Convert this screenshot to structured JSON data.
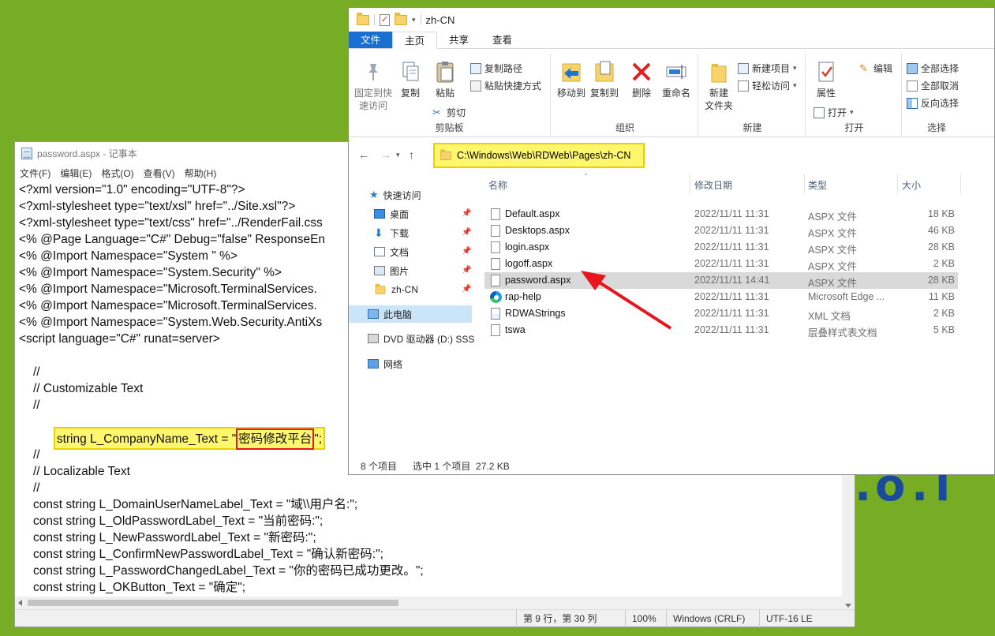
{
  "notepad": {
    "title": "password.aspx - 记事本",
    "menu": [
      "文件(F)",
      "编辑(E)",
      "格式(O)",
      "查看(V)",
      "帮助(H)"
    ],
    "lines": [
      "<?xml version=\"1.0\" encoding=\"UTF-8\"?>",
      "<?xml-stylesheet type=\"text/xsl\" href=\"../Site.xsl\"?>",
      "<?xml-stylesheet type=\"text/css\" href=\"../RenderFail.css",
      "<% @Page Language=\"C#\" Debug=\"false\" ResponseEn",
      "<% @Import Namespace=\"System \" %>",
      "<% @Import Namespace=\"System.Security\" %>",
      "<% @Import Namespace=\"Microsoft.TerminalServices.",
      "<% @Import Namespace=\"Microsoft.TerminalServices.",
      "<% @Import Namespace=\"System.Web.Security.AntiXs",
      "<script language=\"C#\" runat=server>"
    ],
    "block1": [
      "//",
      "// Customizable Text",
      "//"
    ],
    "highlight_prefix": "string L_CompanyName_Text = \"",
    "highlight_value": "密码修改平台",
    "highlight_suffix": "\";",
    "block2": [
      "//",
      "// Localizable Text",
      "//",
      "const string L_DomainUserNameLabel_Text = \"域\\\\用户名:\";",
      "const string L_OldPasswordLabel_Text = \"当前密码:\";",
      "const string L_NewPasswordLabel_Text = \"新密码:\";",
      "const string L_ConfirmNewPasswordLabel_Text = \"确认新密码:\";",
      "const string L_PasswordChangedLabel_Text = \"你的密码已成功更改。\";",
      "const string L_OKButton_Text = \"确定\";"
    ],
    "status": {
      "position": "第 9 行，第 30 列",
      "zoom": "100%",
      "line_ending": "Windows (CRLF)",
      "encoding": "UTF-16 LE"
    }
  },
  "explorer": {
    "title": "zh-CN",
    "tabs": [
      "文件",
      "主页",
      "共享",
      "查看"
    ],
    "ribbon": {
      "pin": "固定到快\n速访问",
      "copy": "复制",
      "paste": "粘贴",
      "copy_path": "复制路径",
      "paste_shortcut": "粘贴快捷方式",
      "cut": "剪切",
      "clipboard": "剪贴板",
      "move_to": "移动到",
      "copy_to": "复制到",
      "delete": "删除",
      "rename": "重命名",
      "organize": "组织",
      "new_folder": "新建\n文件夹",
      "new_item": "新建项目",
      "easy_access": "轻松访问",
      "new": "新建",
      "properties": "属性",
      "open": "打开",
      "edit": "编辑",
      "open_group": "打开",
      "select_all": "全部选择",
      "select_none": "全部取消",
      "invert": "反向选择",
      "select": "选择"
    },
    "address": "C:\\Windows\\Web\\RDWeb\\Pages\\zh-CN",
    "sidebar": {
      "quick_access": "快速访问",
      "desktop": "桌面",
      "downloads": "下载",
      "documents": "文档",
      "pictures": "图片",
      "zhcn": "zh-CN",
      "this_pc": "此电脑",
      "dvd": "DVD 驱动器 (D:) SSS",
      "network": "网络"
    },
    "columns": {
      "name": "名称",
      "date": "修改日期",
      "type": "类型",
      "size": "大小"
    },
    "files": [
      {
        "name": "Default.aspx",
        "date": "2022/11/11 11:31",
        "type": "ASPX 文件",
        "size": "18 KB",
        "icon": "file"
      },
      {
        "name": "Desktops.aspx",
        "date": "2022/11/11 11:31",
        "type": "ASPX 文件",
        "size": "46 KB",
        "icon": "file"
      },
      {
        "name": "login.aspx",
        "date": "2022/11/11 11:31",
        "type": "ASPX 文件",
        "size": "28 KB",
        "icon": "file"
      },
      {
        "name": "logoff.aspx",
        "date": "2022/11/11 11:31",
        "type": "ASPX 文件",
        "size": "2 KB",
        "icon": "file"
      },
      {
        "name": "password.aspx",
        "date": "2022/11/11 14:41",
        "type": "ASPX 文件",
        "size": "28 KB",
        "icon": "file",
        "selected": true
      },
      {
        "name": "rap-help",
        "date": "2022/11/11 11:31",
        "type": "Microsoft Edge ...",
        "size": "11 KB",
        "icon": "edge"
      },
      {
        "name": "RDWAStrings",
        "date": "2022/11/11 11:31",
        "type": "XML 文档",
        "size": "2 KB",
        "icon": "xml"
      },
      {
        "name": "tswa",
        "date": "2022/11/11 11:31",
        "type": "层叠样式表文档",
        "size": "5 KB",
        "icon": "file"
      }
    ],
    "status": {
      "count": "8 个项目",
      "selected": "选中 1 个项目  27.2 KB"
    }
  },
  "colors": {
    "accent": "#1b6ed1",
    "highlight": "#fef76e",
    "annotation": "#e8161c",
    "background": "#77ad24"
  }
}
